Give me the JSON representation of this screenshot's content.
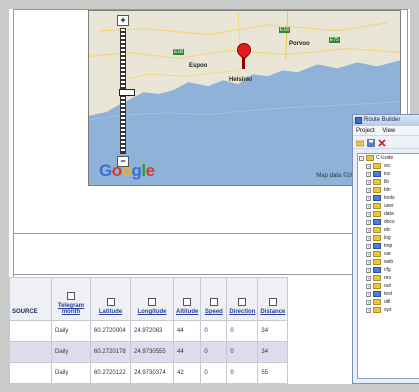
{
  "map": {
    "zoom_in_label": "+",
    "zoom_out_label": "−",
    "logo_text": "Google",
    "credit_text": "Map data ©2009 Tele Atlas",
    "cities": [
      "Porvoo",
      "Espoo",
      "Helsinki"
    ],
    "roads": [
      "E18",
      "E18",
      "E75"
    ]
  },
  "table": {
    "first_header": "SOURCE",
    "columns": [
      "Telegram month",
      "Latitude",
      "Longitude",
      "Altitude",
      "Speed",
      "Direction",
      "Distance"
    ],
    "rows": [
      [
        "",
        "Daily",
        "60.2720004",
        "24.972063",
        "44",
        "0",
        "0",
        "34"
      ],
      [
        "",
        "Daily",
        "60.2720178",
        "24.9730555",
        "44",
        "0",
        "0",
        "34"
      ],
      [
        "",
        "Daily",
        "60.2720122",
        "24.9730374",
        "42",
        "0",
        "0",
        "55"
      ]
    ]
  },
  "app_window": {
    "title": "Route Builder",
    "menu": [
      "Project",
      "View"
    ],
    "tree_root": "C:\\code",
    "tree_items": [
      "src",
      "inc",
      "lib",
      "bin",
      "tools",
      "user",
      "data",
      "docs",
      "etc",
      "log",
      "tmp",
      "var",
      "web",
      "cfg",
      "res",
      "out",
      "test",
      "util",
      "sys"
    ]
  },
  "colors": {
    "frame": "#c9cbc8",
    "table_link": "#2a3e9c",
    "row_alt": "#dcdcec",
    "map_water": "#8fb2d8",
    "map_land": "#eae6d7",
    "marker": "#e21b1b"
  }
}
